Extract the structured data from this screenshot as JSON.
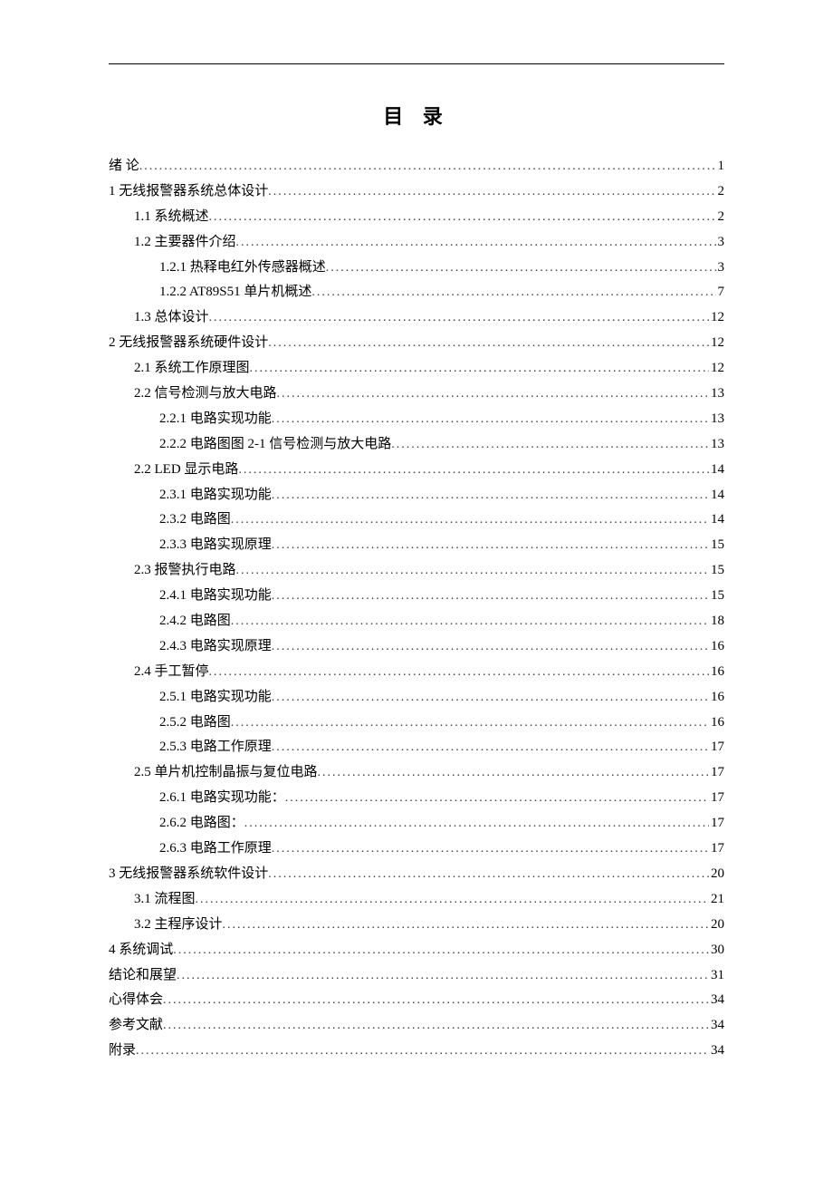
{
  "title": "目 录",
  "toc": [
    {
      "level": 0,
      "label": "绪   论",
      "page": "1"
    },
    {
      "level": 0,
      "label": "1 无线报警器系统总体设计",
      "page": "2"
    },
    {
      "level": 1,
      "label": "1.1  系统概述 ",
      "page": "2"
    },
    {
      "level": 1,
      "label": "1.2 主要器件介绍",
      "page": "3"
    },
    {
      "level": 2,
      "label": "1.2.1 热释电红外传感器概述 ",
      "page": "3"
    },
    {
      "level": 2,
      "label": "1.2.2 AT89S51 单片机概述",
      "page": "7"
    },
    {
      "level": 1,
      "label": "1.3  总体设计 ",
      "page": "12"
    },
    {
      "level": 0,
      "label": "2 无线报警器系统硬件设计",
      "page": "12"
    },
    {
      "level": 1,
      "label": "2.1 系统工作原理图",
      "page": "12"
    },
    {
      "level": 1,
      "label": "2.2 信号检测与放大电路 ",
      "page": "13"
    },
    {
      "level": 2,
      "label": "2.2.1 电路实现功能 ",
      "page": "13"
    },
    {
      "level": 2,
      "label": "2.2.2 电路图图 2-1 信号检测与放大电路 ",
      "page": "13"
    },
    {
      "level": 1,
      "label": "2.2 LED 显示电路",
      "page": "14"
    },
    {
      "level": 2,
      "label": "2.3.1 电路实现功能 ",
      "page": "14"
    },
    {
      "level": 2,
      "label": "2.3.2 电路图 ",
      "page": "14"
    },
    {
      "level": 2,
      "label": "2.3.3 电路实现原理 ",
      "page": "15"
    },
    {
      "level": 1,
      "label": "2.3 报警执行电路 ",
      "page": "15"
    },
    {
      "level": 2,
      "label": "2.4.1 电路实现功能 ",
      "page": "15"
    },
    {
      "level": 2,
      "label": "2.4.2 电路图 ",
      "page": "18"
    },
    {
      "level": 2,
      "label": "2.4.3 电路实现原理 ",
      "page": "16"
    },
    {
      "level": 1,
      "label": "2.4 手工暂停",
      "page": "16"
    },
    {
      "level": 2,
      "label": "2.5.1 电路实现功能 ",
      "page": "16"
    },
    {
      "level": 2,
      "label": "2.5.2 电路图 ",
      "page": "16"
    },
    {
      "level": 2,
      "label": "2.5.3 电路工作原理 ",
      "page": "17"
    },
    {
      "level": 1,
      "label": "2.5 单片机控制晶振与复位电路",
      "page": "17"
    },
    {
      "level": 2,
      "label": "2.6.1 电路实现功能： ",
      "page": "17"
    },
    {
      "level": 2,
      "label": "2.6.2 电路图： ",
      "page": "17"
    },
    {
      "level": 2,
      "label": "2.6.3 电路工作原理 ",
      "page": "17"
    },
    {
      "level": 0,
      "label": "3 无线报警器系统软件设计",
      "page": "20"
    },
    {
      "level": 1,
      "label": "3.1 流程图",
      "page": "21"
    },
    {
      "level": 1,
      "label": "3.2  主程序设计 ",
      "page": "20"
    },
    {
      "level": 0,
      "label": "4 系统调试",
      "page": "30"
    },
    {
      "level": 0,
      "label": "结论和展望",
      "page": "31"
    },
    {
      "level": 0,
      "label": "心得体会",
      "page": "34"
    },
    {
      "level": 0,
      "label": "参考文献",
      "page": "34"
    },
    {
      "level": 0,
      "label": "附录",
      "page": "34"
    }
  ]
}
